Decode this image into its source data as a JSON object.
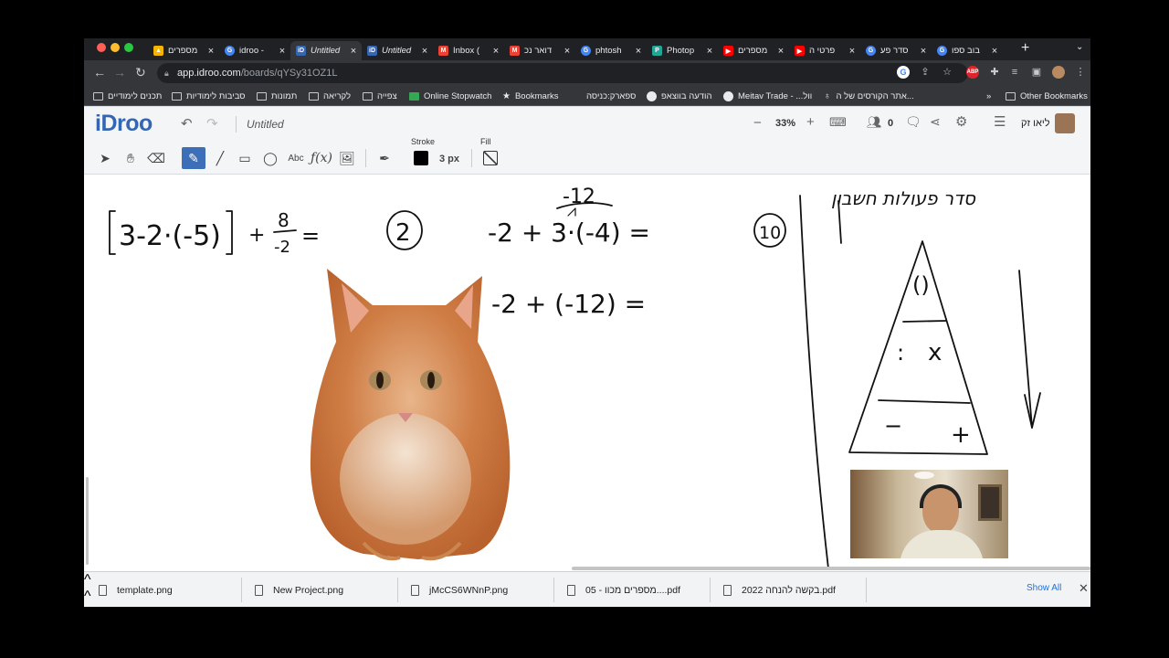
{
  "browser": {
    "tabs": [
      {
        "title": "מספרים",
        "icon": "google-drive-icon",
        "color": "#f4b400"
      },
      {
        "title": "idroo -",
        "icon": "google-icon",
        "color": "#4285f4"
      },
      {
        "title": "Untitled",
        "icon": "idroo-icon",
        "color": "#3566b3",
        "active": true
      },
      {
        "title": "Untitled",
        "icon": "idroo-icon",
        "color": "#3566b3"
      },
      {
        "title": "Inbox (",
        "icon": "gmail-icon",
        "color": "#ea4335"
      },
      {
        "title": "דואר נכ",
        "icon": "gmail-icon",
        "color": "#ea4335"
      },
      {
        "title": "phtosh",
        "icon": "google-icon",
        "color": "#4285f4"
      },
      {
        "title": "Photop",
        "icon": "photopea-icon",
        "color": "#1fa89a"
      },
      {
        "title": "מספרים",
        "icon": "youtube-icon",
        "color": "#ff0000"
      },
      {
        "title": "פרטי ה",
        "icon": "youtube-icon",
        "color": "#ff0000"
      },
      {
        "title": "סדר פע",
        "icon": "google-icon",
        "color": "#4285f4"
      },
      {
        "title": "בוב ספו",
        "icon": "google-icon",
        "color": "#4285f4"
      }
    ],
    "new_tab": "+",
    "tab_menu": "⌄",
    "url_host": "app.idroo.com",
    "url_path": "/boards/qYSy31OZ1L",
    "bookmarks": [
      {
        "label": "תכנים לימודיים",
        "icon": "folder-icon"
      },
      {
        "label": "סביבות לימודיות",
        "icon": "folder-icon"
      },
      {
        "label": "תמונות",
        "icon": "folder-icon"
      },
      {
        "label": "לקריאה",
        "icon": "folder-icon"
      },
      {
        "label": "צפייה",
        "icon": "folder-icon"
      },
      {
        "label": "Online Stopwatch",
        "icon": "stopwatch-icon"
      },
      {
        "label": "Bookmarks",
        "icon": "star-icon"
      },
      {
        "label": "ספארק:כניסה",
        "icon": "spark-icon"
      },
      {
        "label": "הודעה בווצאפ",
        "icon": "whatsapp-icon"
      },
      {
        "label": "Meitav Trade - ...וול",
        "icon": "meitav-icon"
      },
      {
        "label": "אתר הקורסים של ה...",
        "icon": "courses-icon"
      }
    ],
    "bookmarks_more": "»",
    "other_bookmarks": "Other Bookmarks"
  },
  "app": {
    "logo": "iDroo",
    "doc_title": "Untitled",
    "zoom": "33%",
    "participants": "0",
    "user_name": "ליאו זק",
    "stroke_label": "Stroke",
    "fill_label": "Fill",
    "stroke_width": "3 px",
    "stroke_color": "#000000",
    "accent": "#3d6fb8"
  },
  "canvas": {
    "expr1_main": "[3-2·(-5)] + 8/-2 =",
    "label2": "2",
    "expr2_top": "-12",
    "expr2_main": "-2 + 3·(-4) =",
    "expr2_step": "-2 + (-12) =",
    "label10": "10",
    "order_title": "סדר פעולות חשבון",
    "pyramid_top": "()",
    "pyramid_mid_a": ":",
    "pyramid_mid_b": "x",
    "pyramid_bot_a": "−",
    "pyramid_bot_b": "+"
  },
  "downloads": [
    {
      "name": "template.png"
    },
    {
      "name": "New Project.png"
    },
    {
      "name": "jMcCS6WNnP.png"
    },
    {
      "name": "05 - מספרים מכוו....pdf"
    },
    {
      "name": "2022 בקשה להנחה.pdf"
    }
  ],
  "show_all": "Show All"
}
